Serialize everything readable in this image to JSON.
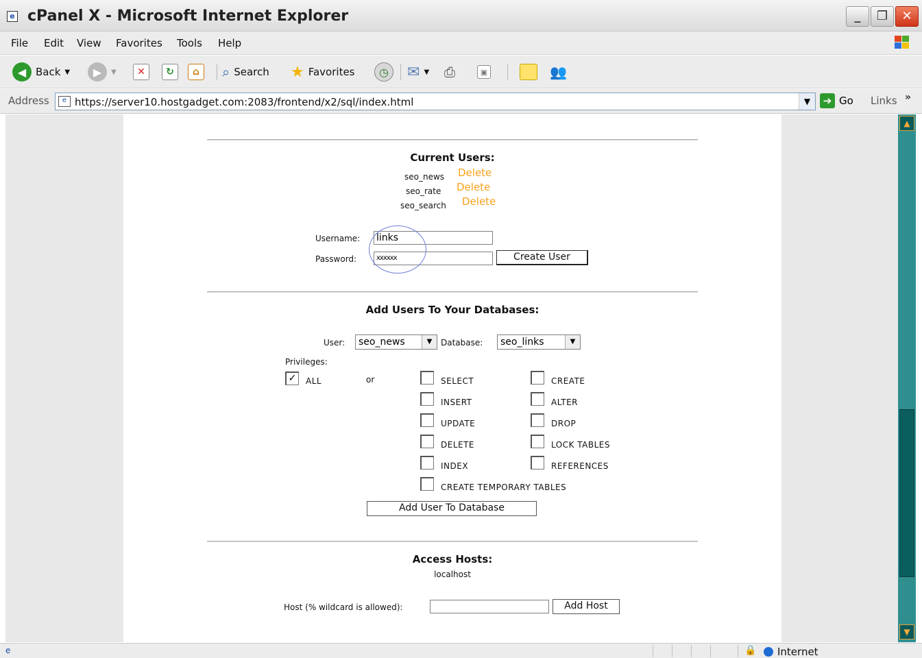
{
  "window": {
    "title": "cPanel X - Microsoft Internet Explorer",
    "minimize_glyph": "_",
    "maximize_glyph": "❐",
    "close_glyph": "✕"
  },
  "menu": {
    "items": [
      "File",
      "Edit",
      "View",
      "Favorites",
      "Tools",
      "Help"
    ]
  },
  "toolbar": {
    "back_label": "Back",
    "search_label": "Search",
    "favorites_label": "Favorites"
  },
  "address": {
    "label": "Address",
    "url": "https://server10.hostgadget.com:2083/frontend/x2/sql/index.html",
    "go_label": "Go",
    "links_label": "Links",
    "chevron": "»"
  },
  "current_users": {
    "heading": "Current Users:",
    "users": [
      {
        "name": "seo_news",
        "action": "Delete"
      },
      {
        "name": "seo_rate",
        "action": "Delete"
      },
      {
        "name": "seo_search",
        "action": "Delete"
      }
    ]
  },
  "create_user": {
    "username_label": "Username:",
    "username_value": "links",
    "password_label": "Password:",
    "password_value": "xxxxxx",
    "button_label": "Create User"
  },
  "add_users": {
    "heading": "Add Users To Your Databases:",
    "user_label": "User:",
    "user_value": "seo_news",
    "database_label": "Database:",
    "database_value": "seo_links",
    "privileges_label": "Privileges:",
    "all_label": "ALL",
    "all_checked": true,
    "or_label": "or",
    "privileges_col1": [
      "SELECT",
      "INSERT",
      "UPDATE",
      "DELETE",
      "INDEX",
      "CREATE TEMPORARY TABLES"
    ],
    "privileges_col2": [
      "CREATE",
      "ALTER",
      "DROP",
      "LOCK TABLES",
      "REFERENCES"
    ],
    "button_label": "Add User To Database"
  },
  "access_hosts": {
    "heading": "Access Hosts:",
    "hosts": [
      "localhost"
    ],
    "host_label": "Host (% wildcard is allowed):",
    "host_value": "",
    "button_label": "Add Host"
  },
  "status": {
    "zone": "Internet"
  },
  "colors": {
    "delete_link": "#f7a11a",
    "scrollbar_track": "#2f8f8f",
    "scrollbar_thumb": "#0b5e5e"
  }
}
